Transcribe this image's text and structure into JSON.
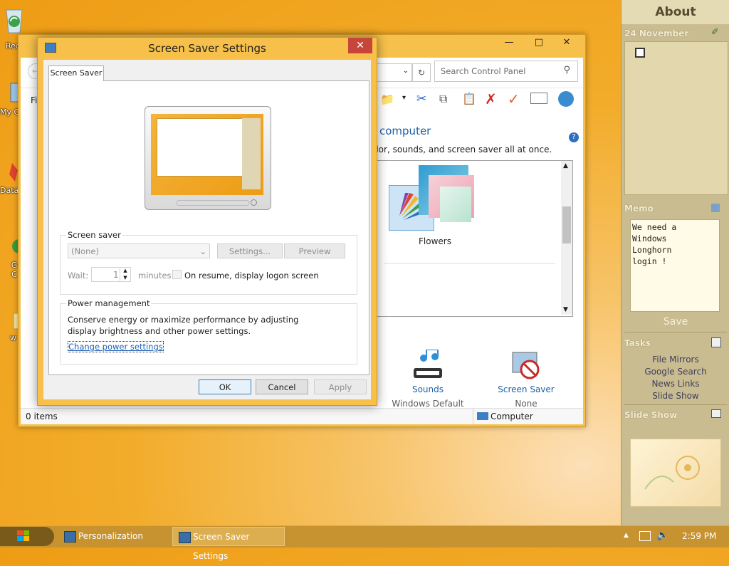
{
  "desktop": {
    "icons": [
      {
        "label": "Rec",
        "icon": "recycle-bin-icon"
      },
      {
        "label": "My C",
        "icon": "computer-icon"
      },
      {
        "label": "Data",
        "icon": "tool-icon"
      },
      {
        "label": "G\nC",
        "icon": "app-icon"
      },
      {
        "label": "w",
        "icon": "folder-icon"
      }
    ]
  },
  "bg_window": {
    "search_placeholder": "Search Control Panel",
    "menu_fi": "Fi",
    "heading": "computer",
    "subtitle": "olor, sounds, and screen saver all at once.",
    "theme_label": "Flowers",
    "sounds_label": "Sounds",
    "sounds_value": "Windows Default",
    "screensaver_label": "Screen Saver",
    "screensaver_value": "None",
    "status_items": "0 items",
    "status_location": "Computer"
  },
  "dialog": {
    "title": "Screen Saver Settings",
    "tab": "Screen Saver",
    "screen_saver_group": "Screen saver",
    "selected": "(None)",
    "settings_button": "Settings...",
    "preview_button": "Preview",
    "wait_label": "Wait:",
    "wait_value": "1",
    "minutes_label": "minutes",
    "resume_label": "On resume, display logon screen",
    "power_group": "Power management",
    "power_text": "Conserve energy or maximize performance by adjusting display brightness and other power settings.",
    "power_link": "Change power settings",
    "ok": "OK",
    "cancel": "Cancel",
    "apply": "Apply"
  },
  "taskbar": {
    "items": [
      "Personalization",
      "Screen Saver Settings"
    ],
    "clock": "2:59 PM"
  },
  "sidebar": {
    "title": "About",
    "date": "24 November",
    "memo_head": "Memo",
    "memo_text": "We need a\nWindows\nLonghorn\nlogin !",
    "save": "Save",
    "tasks_head": "Tasks",
    "tasks": [
      "File Mirrors",
      "Google Search",
      "News Links",
      "Slide Show"
    ],
    "slideshow_head": "Slide Show"
  },
  "colors": {
    "accent": "#f6c04a",
    "close": "#c7463a",
    "link": "#1a5fb4",
    "taskbar": "#c69330"
  }
}
